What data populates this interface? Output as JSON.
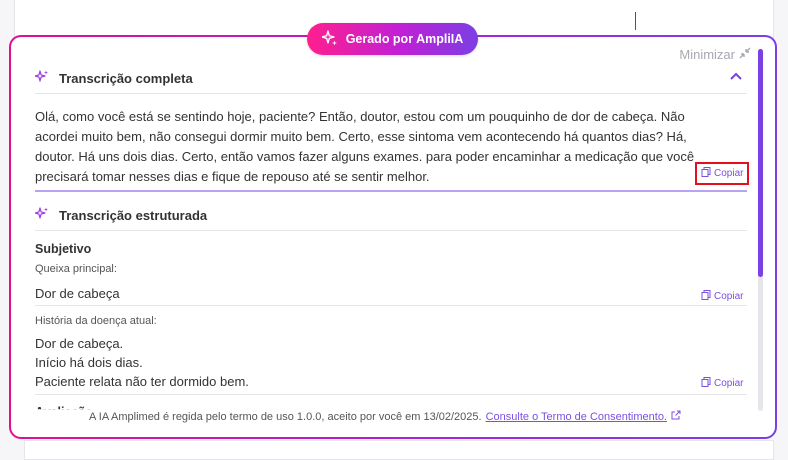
{
  "badge": {
    "label": "Gerado por AmpliIA",
    "icon": "sparkle-icon"
  },
  "minimize_label": "Minimizar",
  "transcription": {
    "title": "Transcrição completa",
    "text": "Olá, como você está se sentindo hoje, paciente? Então, doutor, estou com um pouquinho de dor de cabeça. Não acordei muito bem, não consegui dormir muito bem. Certo, esse sintoma vem acontecendo há quantos dias? Há, doutor. Há uns dois dias. Certo, então vamos fazer alguns exames. para poder encaminhar a medicação que você precisará tomar nesses dias e fique de repouso até se sentir melhor.",
    "copy_label": "Copiar"
  },
  "structured": {
    "title": "Transcrição estruturada",
    "section": "Subjetivo",
    "fields": [
      {
        "label": "Queixa principal:",
        "value": "Dor de cabeça",
        "copy_label": "Copiar"
      },
      {
        "label": "História da doença atual:",
        "lines": [
          "Dor de cabeça.",
          "Início há dois dias.",
          "Paciente relata não ter dormido bem."
        ],
        "copy_label": "Copiar"
      }
    ],
    "next_section_cut": "Avaliação"
  },
  "footer": {
    "text": "A IA Amplimed é regida pelo termo de uso 1.0.0, aceito por você em 13/02/2025.",
    "link": "Consulte o Termo de Consentimento."
  },
  "colors": {
    "accent": "#7b3fe4",
    "pink": "#e0108f",
    "highlight": "#e5101d"
  }
}
